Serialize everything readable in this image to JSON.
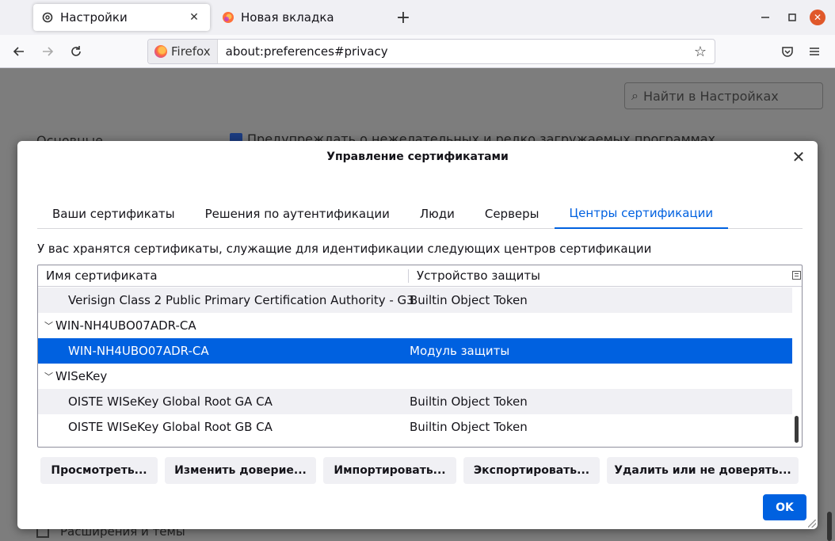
{
  "browser": {
    "tabs": [
      {
        "title": "Настройки",
        "icon": "gear-icon",
        "active": true
      },
      {
        "title": "Новая вкладка",
        "icon": "firefox-icon",
        "active": false
      }
    ],
    "new_tab_symbol": "+",
    "identity_label": "Firefox",
    "url": "about:preferences#privacy"
  },
  "background_page": {
    "search_placeholder": "Найти в Настройках",
    "checkbox_text": "Предупреждать о нежелательных и редко загружаемых программах",
    "section_label": "Основные",
    "extensions_label": "Расширения и темы"
  },
  "dialog": {
    "title": "Управление сертификатами",
    "tabs": [
      {
        "label": "Ваши сертификаты",
        "selected": false
      },
      {
        "label": "Решения по аутентификации",
        "selected": false
      },
      {
        "label": "Люди",
        "selected": false
      },
      {
        "label": "Серверы",
        "selected": false
      },
      {
        "label": "Центры сертификации",
        "selected": true
      }
    ],
    "description": "У вас хранятся сертификаты, служащие для идентификации следующих центров сертификации",
    "columns": {
      "name": "Имя сертификата",
      "device": "Устройство защиты"
    },
    "rows": [
      {
        "type": "cert",
        "name": "Verisign Class 2 Public Primary Certification Authority - G3",
        "device": "Builtin Object Token"
      },
      {
        "type": "group",
        "name": "WIN-NH4UBO07ADR-CA",
        "device": ""
      },
      {
        "type": "cert",
        "name": "WIN-NH4UBO07ADR-CA",
        "device": "Модуль защиты",
        "selected": true
      },
      {
        "type": "group",
        "name": "WISeKey",
        "device": ""
      },
      {
        "type": "cert",
        "name": "OISTE WISeKey Global Root GA CA",
        "device": "Builtin Object Token"
      },
      {
        "type": "cert",
        "name": "OISTE WISeKey Global Root GB CA",
        "device": "Builtin Object Token"
      }
    ],
    "buttons": {
      "view": "Просмотреть...",
      "edit_trust": "Изменить доверие...",
      "import": "Импортировать...",
      "export": "Экспортировать...",
      "delete": "Удалить или не доверять..."
    },
    "ok_label": "OK"
  },
  "colors": {
    "accent": "#0061e0",
    "tab_bar": "#f0f0f4",
    "selected_row_text": "#ffffff"
  }
}
